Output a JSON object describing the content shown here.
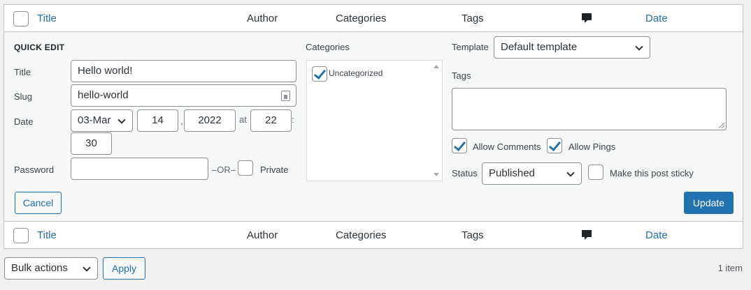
{
  "columns": {
    "title": "Title",
    "author": "Author",
    "categories": "Categories",
    "tags": "Tags",
    "date": "Date"
  },
  "quick_edit": {
    "heading": "QUICK EDIT",
    "title_label": "Title",
    "title_value": "Hello world!",
    "slug_label": "Slug",
    "slug_value": "hello-world",
    "date_label": "Date",
    "month": "03-Mar",
    "day": "14",
    "year": "2022",
    "at": "at",
    "hour": "22",
    "minute": "30",
    "comma": ",",
    "colon": ":",
    "password_label": "Password",
    "password_value": "",
    "or_label": "–OR–",
    "private_label": "Private",
    "private_checked": false,
    "categories_label": "Categories",
    "categories": [
      {
        "label": "Uncategorized",
        "checked": true
      }
    ],
    "template_label": "Template",
    "template_value": "Default template",
    "tags_label": "Tags",
    "tags_value": "",
    "allow_comments_label": "Allow Comments",
    "allow_comments_checked": true,
    "allow_pings_label": "Allow Pings",
    "allow_pings_checked": true,
    "status_label": "Status",
    "status_value": "Published",
    "sticky_label": "Make this post sticky",
    "sticky_checked": false,
    "cancel_label": "Cancel",
    "update_label": "Update"
  },
  "bulk": {
    "selected": "Bulk actions",
    "apply_label": "Apply",
    "item_count": "1 item"
  },
  "icons": {
    "comment": "comment-bubble-icon",
    "chevron": "chevron-down-icon",
    "slug": "lock-icon"
  },
  "colors": {
    "accent": "#2271b1",
    "background": "#f0f0f1",
    "panel": "#f6f7f7"
  }
}
